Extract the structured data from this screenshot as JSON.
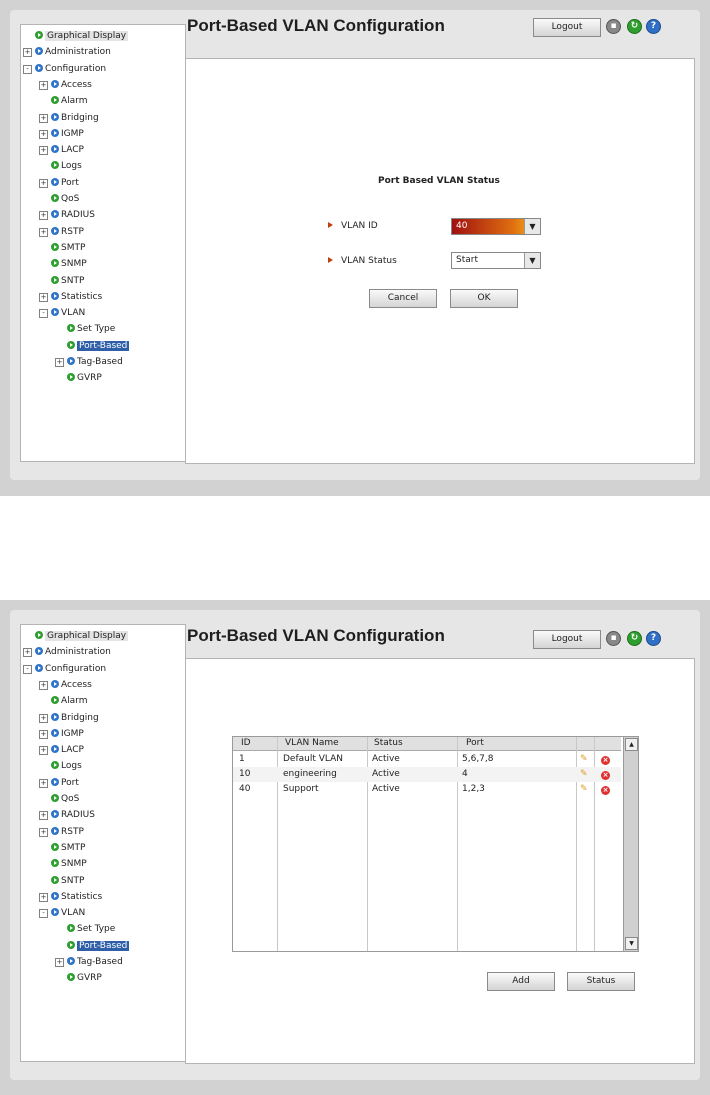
{
  "screens": [
    {
      "title": "Port-Based VLAN Configuration",
      "logout": "Logout",
      "form": {
        "heading": "Port Based VLAN Status",
        "vlan_id_label": "VLAN ID",
        "vlan_id_value": "40",
        "vlan_status_label": "VLAN Status",
        "vlan_status_value": "Start",
        "cancel": "Cancel",
        "ok": "OK"
      }
    },
    {
      "title": "Port-Based VLAN Configuration",
      "logout": "Logout",
      "table": {
        "headers": [
          "ID",
          "VLAN Name",
          "Status",
          "Port"
        ],
        "rows": [
          {
            "id": "1",
            "name": "Default VLAN",
            "status": "Active",
            "port": "5,6,7,8"
          },
          {
            "id": "10",
            "name": "engineering",
            "status": "Active",
            "port": "4"
          },
          {
            "id": "40",
            "name": "Support",
            "status": "Active",
            "port": "1,2,3"
          }
        ]
      },
      "add": "Add",
      "status_btn": "Status"
    }
  ],
  "tree": [
    {
      "label": "Graphical Display",
      "level": 0,
      "expander": "",
      "color": "green",
      "state": "highlight"
    },
    {
      "label": "Administration",
      "level": 0,
      "expander": "+",
      "color": "blue"
    },
    {
      "label": "Configuration",
      "level": 0,
      "expander": "-",
      "color": "blue"
    },
    {
      "label": "Access",
      "level": 1,
      "expander": "+",
      "color": "blue"
    },
    {
      "label": "Alarm",
      "level": 1,
      "expander": "",
      "color": "green"
    },
    {
      "label": "Bridging",
      "level": 1,
      "expander": "+",
      "color": "blue"
    },
    {
      "label": "IGMP",
      "level": 1,
      "expander": "+",
      "color": "blue"
    },
    {
      "label": "LACP",
      "level": 1,
      "expander": "+",
      "color": "blue"
    },
    {
      "label": "Logs",
      "level": 1,
      "expander": "",
      "color": "green"
    },
    {
      "label": "Port",
      "level": 1,
      "expander": "+",
      "color": "blue"
    },
    {
      "label": "QoS",
      "level": 1,
      "expander": "",
      "color": "green"
    },
    {
      "label": "RADIUS",
      "level": 1,
      "expander": "+",
      "color": "blue"
    },
    {
      "label": "RSTP",
      "level": 1,
      "expander": "+",
      "color": "blue"
    },
    {
      "label": "SMTP",
      "level": 1,
      "expander": "",
      "color": "green"
    },
    {
      "label": "SNMP",
      "level": 1,
      "expander": "",
      "color": "green"
    },
    {
      "label": "SNTP",
      "level": 1,
      "expander": "",
      "color": "green"
    },
    {
      "label": "Statistics",
      "level": 1,
      "expander": "+",
      "color": "blue"
    },
    {
      "label": "VLAN",
      "level": 1,
      "expander": "-",
      "color": "blue"
    },
    {
      "label": "Set Type",
      "level": 2,
      "expander": "",
      "color": "green"
    },
    {
      "label": "Port-Based",
      "level": 2,
      "expander": "",
      "color": "green",
      "state": "selected"
    },
    {
      "label": "Tag-Based",
      "level": 2,
      "expander": "+",
      "color": "blue"
    },
    {
      "label": "GVRP",
      "level": 2,
      "expander": "",
      "color": "green"
    }
  ]
}
